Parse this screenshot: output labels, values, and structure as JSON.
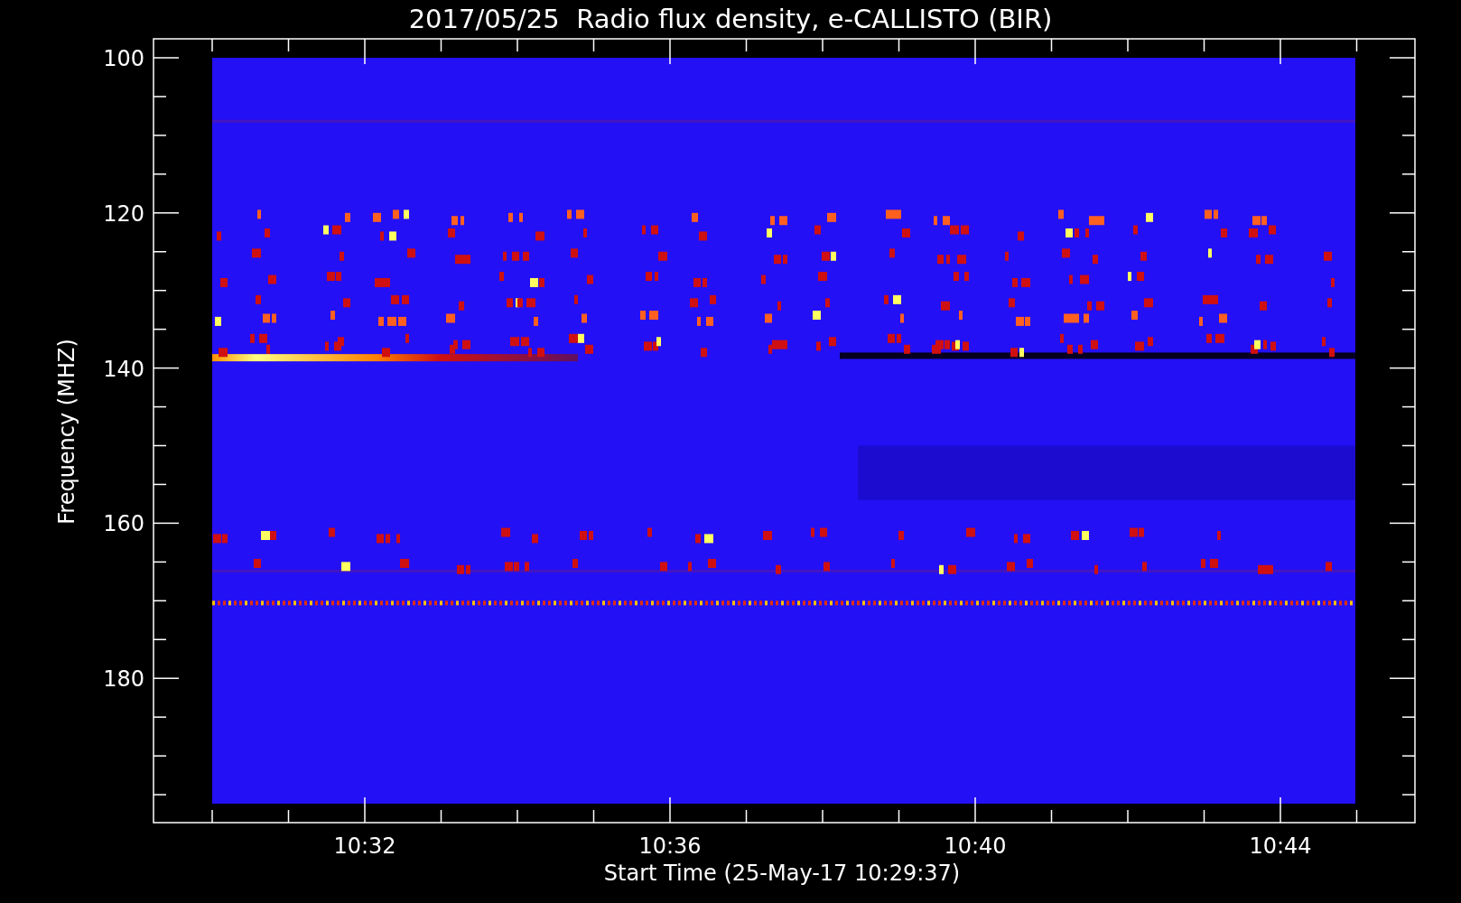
{
  "title": "2017/05/25  Radio flux density, e-CALLISTO (BIR)",
  "y_axis": {
    "label": "Frequency (MHZ)",
    "tick_labels": [
      "100",
      "120",
      "140",
      "160",
      "180"
    ]
  },
  "x_axis": {
    "label": "Start Time (25-May-17 10:29:37)",
    "tick_labels": [
      "10:32",
      "10:36",
      "10:40",
      "10:44"
    ]
  }
}
